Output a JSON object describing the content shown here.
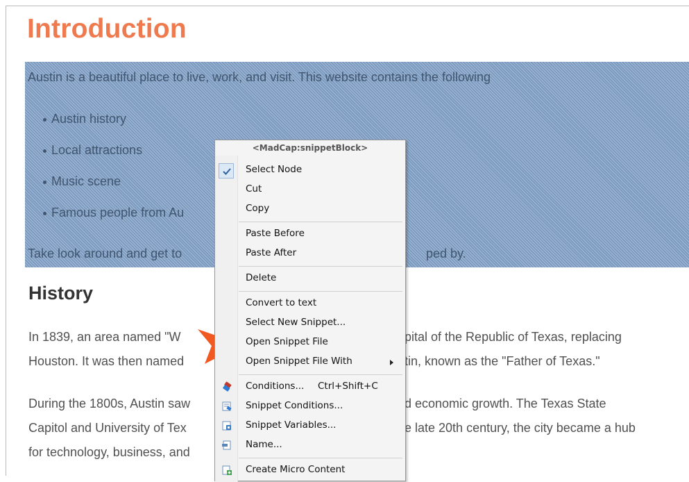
{
  "heading": "Introduction",
  "snippet": {
    "intro": "Austin is a beautiful place to live, work, and visit. This website contains the following",
    "bullets": [
      "Austin history",
      "Local attractions",
      "Music scene",
      "Famous people from Au"
    ],
    "closing_left": "Take look around and get to",
    "closing_right": "ped by."
  },
  "history": {
    "title": "History",
    "p1_line1_left": "In 1839, an area named \"W",
    "p1_line1_right": "pital of the Republic of Texas, replacing",
    "p1_line2_left": "Houston. It was then named",
    "p1_line2_right": "tin, known as the \"Father of Texas.\"",
    "p2_line1_left": "During the 1800s, Austin saw",
    "p2_line1_right": "d economic growth. The Texas State",
    "p2_line2_left": "Capitol and University of Tex",
    "p2_line2_right": "e late 20th century, the city became a hub",
    "p2_line3_left": "for technology, business, and"
  },
  "context_menu": {
    "header": "<MadCap:snippetBlock>",
    "items": {
      "select_node": "Select Node",
      "cut": "Cut",
      "copy": "Copy",
      "paste_before": "Paste Before",
      "paste_after": "Paste After",
      "delete": "Delete",
      "convert_to_text": "Convert to text",
      "select_new_snippet": "Select New Snippet...",
      "open_snippet_file": "Open Snippet File",
      "open_snippet_file_with": "Open Snippet File With",
      "conditions": "Conditions...",
      "conditions_shortcut": "Ctrl+Shift+C",
      "snippet_conditions": "Snippet Conditions...",
      "snippet_variables": "Snippet Variables...",
      "name": "Name...",
      "create_micro_content": "Create Micro Content"
    },
    "icons": [
      "check-icon",
      "conditions-tag-icon",
      "snippet-conditions-icon",
      "snippet-variables-icon",
      "name-icon",
      "create-micro-content-icon",
      "submenu-arrow-icon"
    ]
  },
  "colors": {
    "heading": "#ef7a4e",
    "selection": "#7b9ac0",
    "callout_arrow": "#f05a22"
  }
}
